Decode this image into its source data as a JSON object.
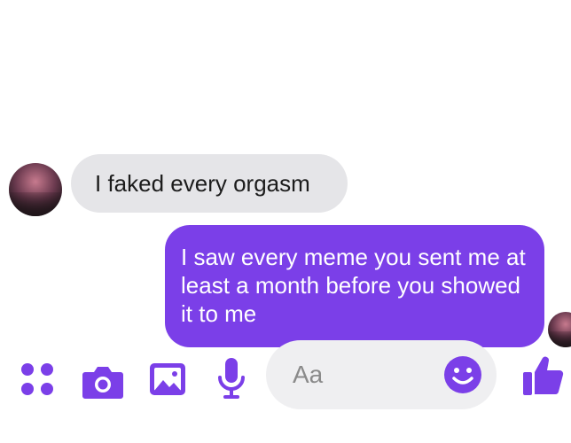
{
  "messages": [
    {
      "direction": "incoming",
      "text": "I faked every orgasm"
    },
    {
      "direction": "outgoing",
      "text": "I saw every meme you sent me at least a month before you showed it to me"
    }
  ],
  "composer": {
    "placeholder": "Aa",
    "icons": [
      "apps-icon",
      "camera-icon",
      "gallery-icon",
      "microphone-icon",
      "emoji-icon",
      "thumbs-up-icon"
    ]
  },
  "colors": {
    "accent": "#7b3fe8",
    "incoming_bubble": "#e5e5e8",
    "outgoing_bubble": "#7b3fe8",
    "composer_field": "#efeff1"
  }
}
